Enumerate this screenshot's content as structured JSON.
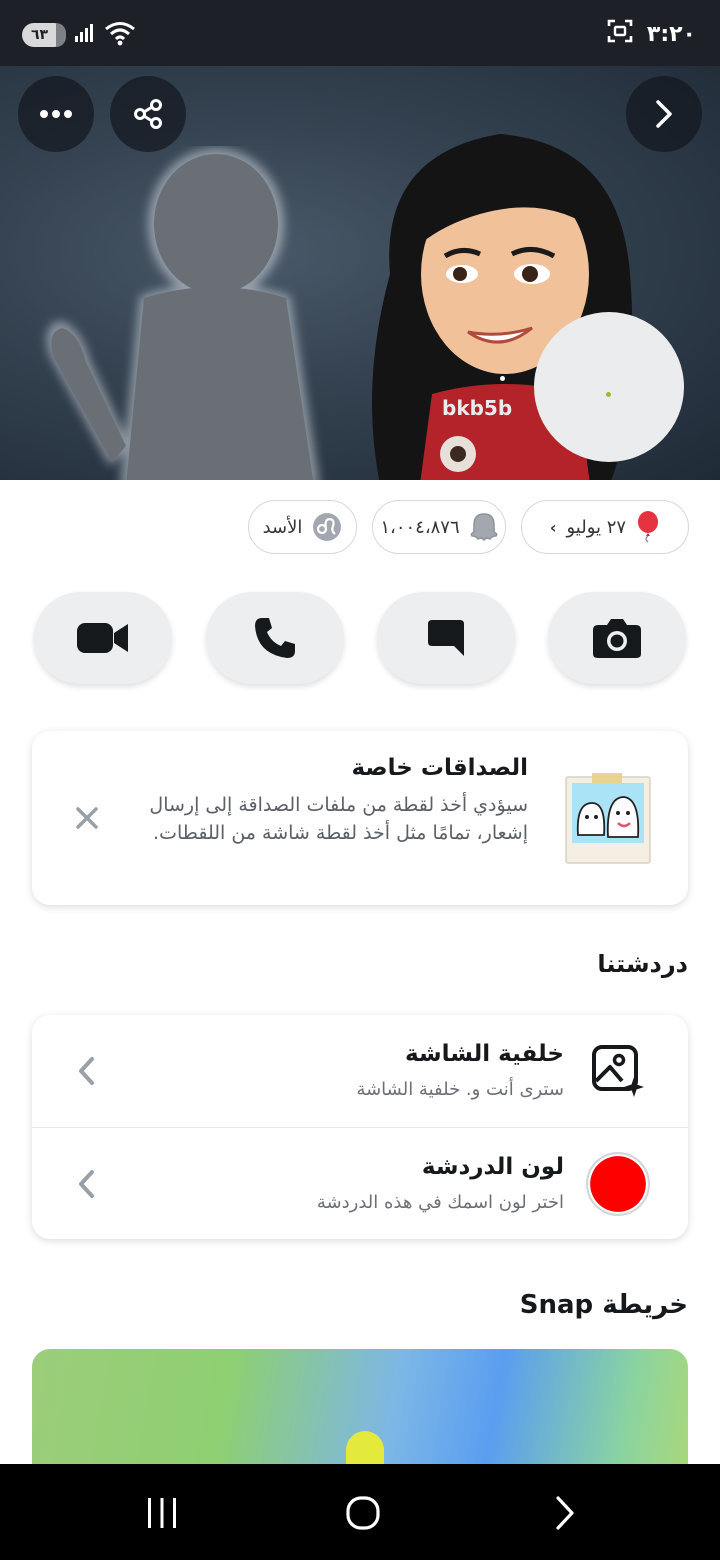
{
  "status_bar": {
    "battery": "٦٣",
    "time": "٣:٢٠"
  },
  "profile": {
    "username": "bkb5b"
  },
  "pills": {
    "birthday": "٢٧ يوليو",
    "score": "١،٠٠٤،٨٧٦",
    "zodiac": "الأسد"
  },
  "friendship_card": {
    "title": "الصداقات خاصة",
    "description": "سيؤدي أخذ لقطة من ملفات الصداقة إلى إرسال إشعار، تمامًا مثل أخذ لقطة شاشة من اللقطات."
  },
  "sections": {
    "our_chat": "دردشتنا",
    "snap_map": "خريطة Snap"
  },
  "chat_settings": [
    {
      "title": "خلفية الشاشة",
      "subtitle": "سترى أنت و. خلفية الشاشة"
    },
    {
      "title": "لون الدردشة",
      "subtitle": "اختر لون اسمك في هذه الدردشة"
    }
  ],
  "colors": {
    "chat_color": "#ff0000",
    "status_bar": "#1d2127",
    "card_bg": "#ffffff",
    "button_bg": "#edeef0"
  }
}
